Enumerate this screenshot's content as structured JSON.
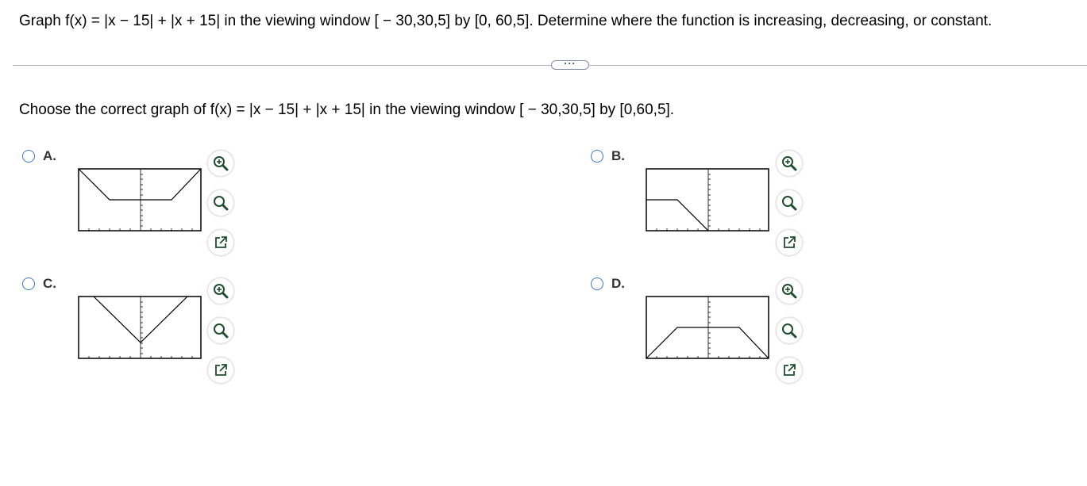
{
  "question": {
    "text": "Graph f(x) = |x − 15| + |x + 15| in the viewing window [ − 30,30,5] by [0, 60,5]. Determine where the function is increasing, decreasing, or constant."
  },
  "expand_button": {
    "label": "···"
  },
  "prompt": {
    "text": "Choose the correct graph of f(x) = |x − 15| + |x + 15| in the viewing window [ − 30,30,5] by [0,60,5]."
  },
  "options": [
    {
      "key": "A",
      "label": "A."
    },
    {
      "key": "B",
      "label": "B."
    },
    {
      "key": "C",
      "label": "C."
    },
    {
      "key": "D",
      "label": "D."
    }
  ],
  "tools": {
    "zoom_in": "zoom-in-icon",
    "zoom_out": "zoom-out-icon",
    "open": "open-in-new-window-icon"
  },
  "colors": {
    "radio_border": "#3a78c9",
    "tool_icon": "#1f4e2e",
    "divider": "#b8b8b8"
  }
}
